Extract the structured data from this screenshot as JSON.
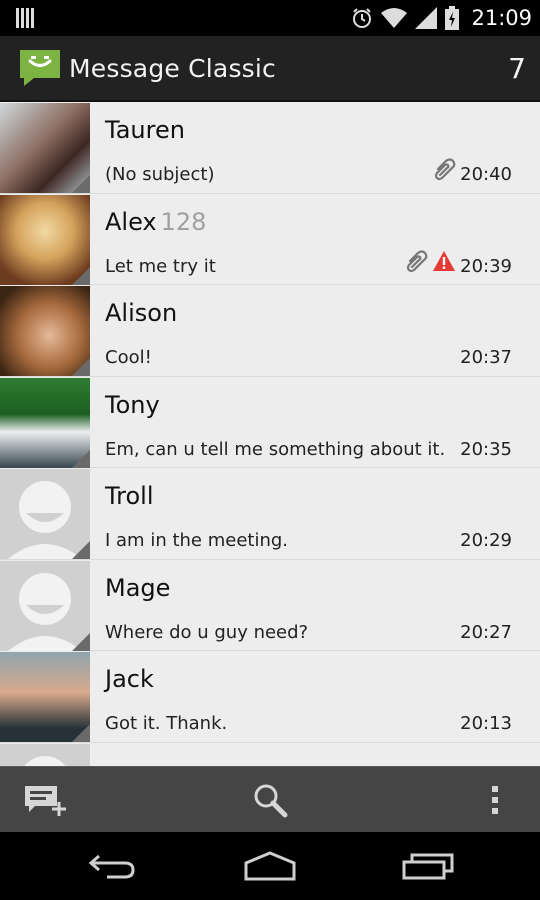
{
  "status_bar": {
    "time": "21:09",
    "icons": [
      "notification-icon",
      "alarm-icon",
      "wifi-icon",
      "signal-icon",
      "battery-charging-icon"
    ]
  },
  "action_bar": {
    "title": "Message Classic",
    "unread_count": "7",
    "logo_icon": "chat-bubble-smile-icon"
  },
  "conversations": [
    {
      "name": "Tauren",
      "count": "",
      "preview": "(No subject)",
      "time": "20:40",
      "attachment": true,
      "error": false,
      "avatar": "photo"
    },
    {
      "name": "Alex",
      "count": "128",
      "preview": "Let me try it",
      "time": "20:39",
      "attachment": true,
      "error": true,
      "avatar": "photo"
    },
    {
      "name": "Alison",
      "count": "",
      "preview": "Cool!",
      "time": "20:37",
      "attachment": false,
      "error": false,
      "avatar": "photo"
    },
    {
      "name": "Tony",
      "count": "",
      "preview": "Em, can u tell me something about it.",
      "time": "20:35",
      "attachment": false,
      "error": false,
      "avatar": "photo"
    },
    {
      "name": "Troll",
      "count": "",
      "preview": "I am in the meeting.",
      "time": "20:29",
      "attachment": false,
      "error": false,
      "avatar": "default"
    },
    {
      "name": "Mage",
      "count": "",
      "preview": "Where  do u guy need?",
      "time": "20:27",
      "attachment": false,
      "error": false,
      "avatar": "default"
    },
    {
      "name": "Jack",
      "count": "",
      "preview": "Got it. Thank.",
      "time": "20:13",
      "attachment": false,
      "error": false,
      "avatar": "photo"
    }
  ],
  "toolbar": {
    "compose_icon": "compose-message-icon",
    "search_icon": "search-icon",
    "overflow_icon": "overflow-menu-icon"
  },
  "navbar": {
    "back_icon": "back-icon",
    "home_icon": "home-icon",
    "recents_icon": "recent-apps-icon"
  },
  "colors": {
    "action_bar": "#222222",
    "list_bg": "#ececec",
    "toolbar": "#454545",
    "error_red": "#e53935",
    "logo_green": "#7cb342"
  }
}
